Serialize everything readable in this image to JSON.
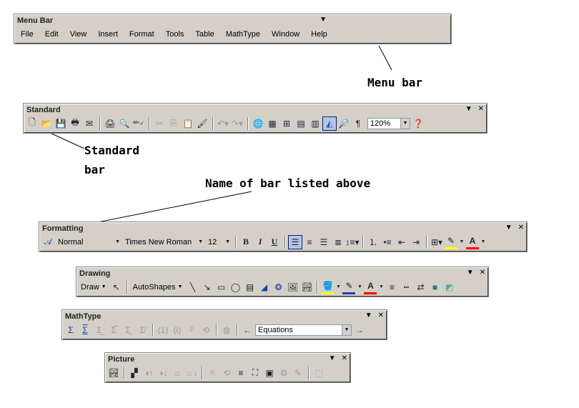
{
  "menu_bar": {
    "title": "Menu Bar",
    "items": [
      "File",
      "Edit",
      "View",
      "Insert",
      "Format",
      "Tools",
      "Table",
      "MathType",
      "Window",
      "Help"
    ]
  },
  "standard": {
    "title": "Standard",
    "zoom": "120%"
  },
  "formatting": {
    "title": "Formatting",
    "style": "Normal",
    "font": "Times New Roman",
    "size": "12",
    "bold": "B",
    "italic": "I",
    "underline": "U"
  },
  "drawing": {
    "title": "Drawing",
    "draw_label": "Draw",
    "autoshapes_label": "AutoShapes"
  },
  "mathtype": {
    "title": "MathType",
    "equations": "Equations"
  },
  "picture": {
    "title": "Picture"
  },
  "annotations": {
    "menu_bar": "Menu bar",
    "standard_line1": "Standard",
    "standard_line2": "bar",
    "name_of_bar": "Name of bar listed above"
  },
  "colors": {
    "toolbar_bg": "#d4d0c8",
    "highlight": "#ffff00",
    "font_color": "#ff0000"
  }
}
